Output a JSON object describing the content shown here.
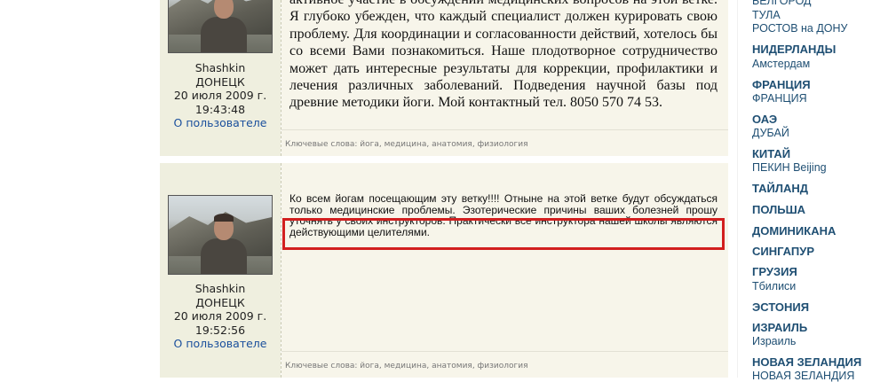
{
  "posts": [
    {
      "author": "Shashkin",
      "city": "ДОНЕЦК",
      "date": "20 июля 2009 г.",
      "time": "19:43:48",
      "profile_link": "О пользователе",
      "text": "активное участие в обсуждении медицинских вопросов на этой ветке. Я глубоко убежден, что каждый специалист должен курировать свою проблему. Для координации и согласованности действий, хотелось бы со всеми Вами познакомиться. Наше плодотворное сотрудничество может дать интересные результаты для коррекции, профилактики и лечения различных заболеваний. Подведения научной базы под древние методики йоги. Мой контактный тел. 8050 570 74 53.",
      "keywords": "Ключевые слова: йога, медицина, анатомия, физиология"
    },
    {
      "author": "Shashkin",
      "city": "ДОНЕЦК",
      "date": "20 июля 2009 г.",
      "time": "19:52:56",
      "profile_link": "О пользователе",
      "text": "Ко всем йогам посещающим эту ветку!!!! Отныне на этой ветке будут обсуждаться только медицинские проблемы. Эзотерические причины ваших болезней прошу уточнять у своих инструкторов. Практически все инструктора нашей школы являются действующими целителями.",
      "keywords": "Ключевые слова: йога, медицина, анатомия, физиология"
    }
  ],
  "sidebar": {
    "items": [
      {
        "label": "БЕЛГОРОД",
        "kind": "city"
      },
      {
        "label": "ТУЛА",
        "kind": "city"
      },
      {
        "label": "РОСТОВ на ДОНУ",
        "kind": "city"
      },
      {
        "label": "НИДЕРЛАНДЫ",
        "kind": "country"
      },
      {
        "label": "Амстердам",
        "kind": "city"
      },
      {
        "label": "ФРАНЦИЯ",
        "kind": "country"
      },
      {
        "label": "ФРАНЦИЯ",
        "kind": "city"
      },
      {
        "label": "ОАЭ",
        "kind": "country"
      },
      {
        "label": "ДУБАЙ",
        "kind": "city"
      },
      {
        "label": "КИТАЙ",
        "kind": "country"
      },
      {
        "label": "ПЕКИН Beijing",
        "kind": "city"
      },
      {
        "label": "ТАЙЛАНД",
        "kind": "country"
      },
      {
        "label": "ПОЛЬША",
        "kind": "country"
      },
      {
        "label": "ДОМИНИКАНА",
        "kind": "country"
      },
      {
        "label": "СИНГАПУР",
        "kind": "country"
      },
      {
        "label": "ГРУЗИЯ",
        "kind": "country"
      },
      {
        "label": "Тбилиси",
        "kind": "city"
      },
      {
        "label": "ЭСТОНИЯ",
        "kind": "country"
      },
      {
        "label": "ИЗРАИЛЬ",
        "kind": "country"
      },
      {
        "label": "Израиль",
        "kind": "city"
      },
      {
        "label": "НОВАЯ ЗЕЛАНДИЯ",
        "kind": "country"
      },
      {
        "label": "НОВАЯ ЗЕЛАНДИЯ",
        "kind": "city"
      }
    ]
  },
  "colors": {
    "link": "#1a4f9c",
    "sidebar_text": "#1f4f73",
    "highlight_border": "#d21f1f",
    "author_bg": "#efefdf",
    "message_bg": "#f7f5ea"
  }
}
